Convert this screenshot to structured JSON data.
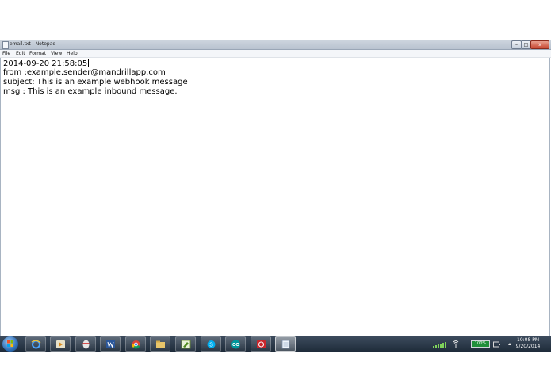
{
  "window": {
    "title": "email.txt - Notepad"
  },
  "window_controls": {
    "minimize": "–",
    "maximize": "□",
    "close": "x"
  },
  "menu": {
    "items": [
      "File",
      "Edit",
      "Format",
      "View",
      "Help"
    ]
  },
  "document": {
    "lines": [
      "2014-09-20 21:58:05",
      "from :example.sender@mandrillapp.com",
      "subject: This is an example webhook message",
      "msg : This is an example inbound message."
    ]
  },
  "taskbar": {
    "pinned_icons": [
      "internet-explorer-icon",
      "media-player-icon",
      "mouse-app-icon",
      "word-icon",
      "chrome-icon",
      "file-explorer-icon",
      "photo-editor-icon",
      "skype-icon",
      "arduino-icon",
      "media-app-icon",
      "notepad-icon"
    ]
  },
  "tray": {
    "battery": "100%",
    "time": "10:08 PM",
    "date": "9/20/2014"
  },
  "colors": {
    "taskbar": "#2b3a4b",
    "battery": "#1f8f3a",
    "close_button": "#c7452f"
  }
}
